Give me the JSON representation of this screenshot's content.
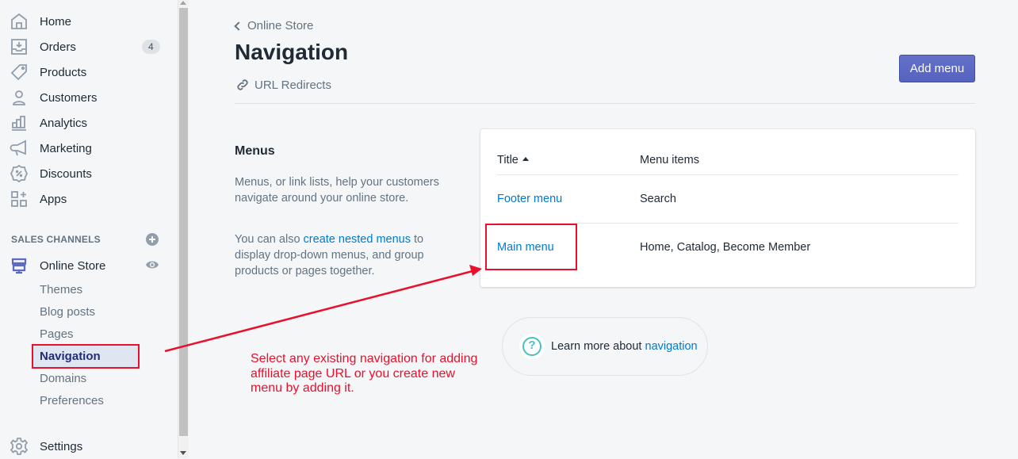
{
  "sidebar": {
    "items": [
      {
        "label": "Home",
        "icon": "home-icon"
      },
      {
        "label": "Orders",
        "icon": "orders-icon",
        "badge": "4"
      },
      {
        "label": "Products",
        "icon": "tag-icon"
      },
      {
        "label": "Customers",
        "icon": "person-icon"
      },
      {
        "label": "Analytics",
        "icon": "bar-chart-icon"
      },
      {
        "label": "Marketing",
        "icon": "megaphone-icon"
      },
      {
        "label": "Discounts",
        "icon": "discount-icon"
      },
      {
        "label": "Apps",
        "icon": "apps-icon"
      }
    ],
    "sales_channels_title": "SALES CHANNELS",
    "online_store": {
      "label": "Online Store",
      "sub_items": [
        "Themes",
        "Blog posts",
        "Pages",
        "Navigation",
        "Domains",
        "Preferences"
      ],
      "active": "Navigation"
    },
    "settings_label": "Settings"
  },
  "header": {
    "breadcrumb": "Online Store",
    "title": "Navigation",
    "secondary_action": "URL Redirects",
    "primary_action": "Add menu"
  },
  "menus_section": {
    "heading": "Menus",
    "description": "Menus, or link lists, help your customers navigate around your online store.",
    "nested_prefix": "You can also ",
    "nested_link": "create nested menus",
    "nested_suffix": " to display drop-down menus, and group products or pages together."
  },
  "table": {
    "columns": [
      "Title",
      "Menu items"
    ],
    "sort": "Title ascending",
    "rows": [
      {
        "title": "Footer menu",
        "items": "Search"
      },
      {
        "title": "Main menu",
        "items": "Home, Catalog, Become Member"
      }
    ]
  },
  "learn_more": {
    "prefix": "Learn more about ",
    "link": "navigation"
  },
  "annotation": {
    "text": "Select any existing navigation for adding affiliate page URL or you create new menu by adding it.",
    "color": "#e8102c"
  },
  "colors": {
    "accent": "#5c6ac4",
    "link": "#007ace",
    "highlight": "#e8102c"
  }
}
